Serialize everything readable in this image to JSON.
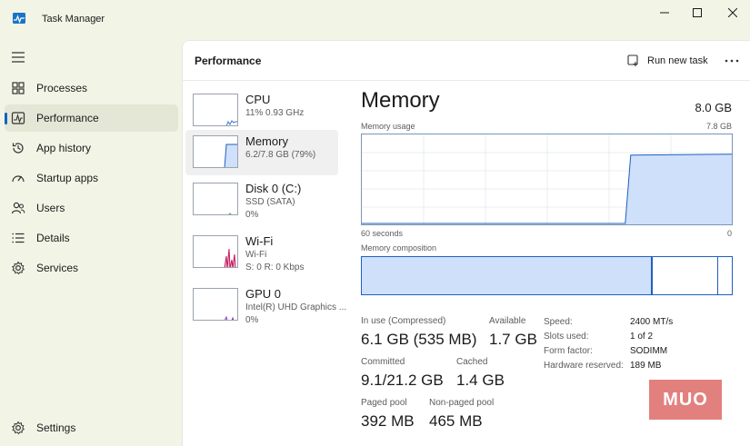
{
  "window": {
    "title": "Task Manager"
  },
  "sidebar": {
    "items": [
      {
        "label": "Processes",
        "icon": "grid-icon"
      },
      {
        "label": "Performance",
        "icon": "pulse-icon"
      },
      {
        "label": "App history",
        "icon": "history-icon"
      },
      {
        "label": "Startup apps",
        "icon": "speedometer-icon"
      },
      {
        "label": "Users",
        "icon": "users-icon"
      },
      {
        "label": "Details",
        "icon": "list-icon"
      },
      {
        "label": "Services",
        "icon": "gear-icon"
      }
    ],
    "settings_label": "Settings",
    "active": "Performance"
  },
  "header": {
    "title": "Performance",
    "run_new_task": "Run new task"
  },
  "resources": [
    {
      "name": "CPU",
      "sub1": "11%  0.93 GHz",
      "sub2": ""
    },
    {
      "name": "Memory",
      "sub1": "6.2/7.8 GB (79%)",
      "sub2": ""
    },
    {
      "name": "Disk 0 (C:)",
      "sub1": "SSD (SATA)",
      "sub2": "0%"
    },
    {
      "name": "Wi-Fi",
      "sub1": "Wi-Fi",
      "sub2": "S: 0  R: 0 Kbps"
    },
    {
      "name": "GPU 0",
      "sub1": "Intel(R) UHD Graphics ...",
      "sub2": "0%"
    }
  ],
  "detail": {
    "title": "Memory",
    "total": "8.0 GB",
    "usage_label": "Memory usage",
    "usage_max": "7.8 GB",
    "time_left": "60 seconds",
    "time_right": "0",
    "composition_label": "Memory composition",
    "usage_fraction": 0.79,
    "stats": {
      "in_use_label": "In use (Compressed)",
      "in_use_value": "6.1 GB (535 MB)",
      "available_label": "Available",
      "available_value": "1.7 GB",
      "committed_label": "Committed",
      "committed_value": "9.1/21.2 GB",
      "cached_label": "Cached",
      "cached_value": "1.4 GB",
      "paged_label": "Paged pool",
      "paged_value": "392 MB",
      "nonpaged_label": "Non-paged pool",
      "nonpaged_value": "465 MB"
    },
    "hardware": [
      {
        "label": "Speed:",
        "value": "2400 MT/s"
      },
      {
        "label": "Slots used:",
        "value": "1 of 2"
      },
      {
        "label": "Form factor:",
        "value": "SODIMM"
      },
      {
        "label": "Hardware reserved:",
        "value": "189 MB"
      }
    ]
  },
  "watermark": {
    "text": "MUO"
  },
  "colors": {
    "accent": "#0b64c4",
    "memory_fill": "#cfe0fb",
    "memory_line": "#1f5fbf",
    "wifi_line": "#c2185b",
    "gpu_line": "#7b3fbf",
    "disk_line": "#4caf50"
  }
}
